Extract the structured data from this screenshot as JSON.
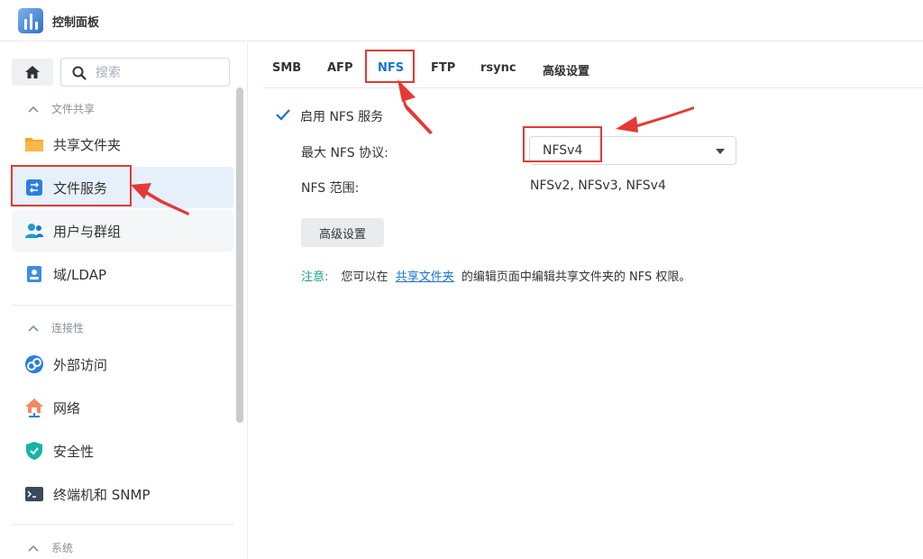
{
  "window": {
    "title": "控制面板"
  },
  "sidebar": {
    "search_placeholder": "搜索",
    "groups": [
      {
        "label": "文件共享"
      },
      {
        "label": "连接性"
      },
      {
        "label": "系统"
      }
    ],
    "items": [
      {
        "label": "共享文件夹",
        "icon": "shared-folder-icon"
      },
      {
        "label": "文件服务",
        "icon": "file-services-icon"
      },
      {
        "label": "用户与群组",
        "icon": "users-icon"
      },
      {
        "label": "域/LDAP",
        "icon": "domain-icon"
      },
      {
        "label": "外部访问",
        "icon": "external-access-icon"
      },
      {
        "label": "网络",
        "icon": "network-icon"
      },
      {
        "label": "安全性",
        "icon": "shield-icon"
      },
      {
        "label": "终端机和 SNMP",
        "icon": "terminal-icon"
      }
    ]
  },
  "tabs": [
    {
      "label": "SMB"
    },
    {
      "label": "AFP"
    },
    {
      "label": "NFS",
      "active": true
    },
    {
      "label": "FTP"
    },
    {
      "label": "rsync"
    },
    {
      "label": "高级设置"
    }
  ],
  "nfs": {
    "enable_label": "启用 NFS 服务",
    "enable_checked": true,
    "max_protocol_label": "最大 NFS 协议:",
    "max_protocol_value": "NFSv4",
    "range_label": "NFS 范围:",
    "range_value": "NFSv2, NFSv3, NFSv4",
    "advanced_button": "高级设置",
    "note": {
      "prefix": "注意:",
      "text_before": "您可以在",
      "link": "共享文件夹",
      "text_after": "的编辑页面中编辑共享文件夹的 NFS 权限。"
    }
  },
  "colors": {
    "accent": "#1a73d2",
    "annotation_red": "#e53935",
    "note_green": "#1aa08a",
    "active_item_bg": "#e6f0fb"
  }
}
